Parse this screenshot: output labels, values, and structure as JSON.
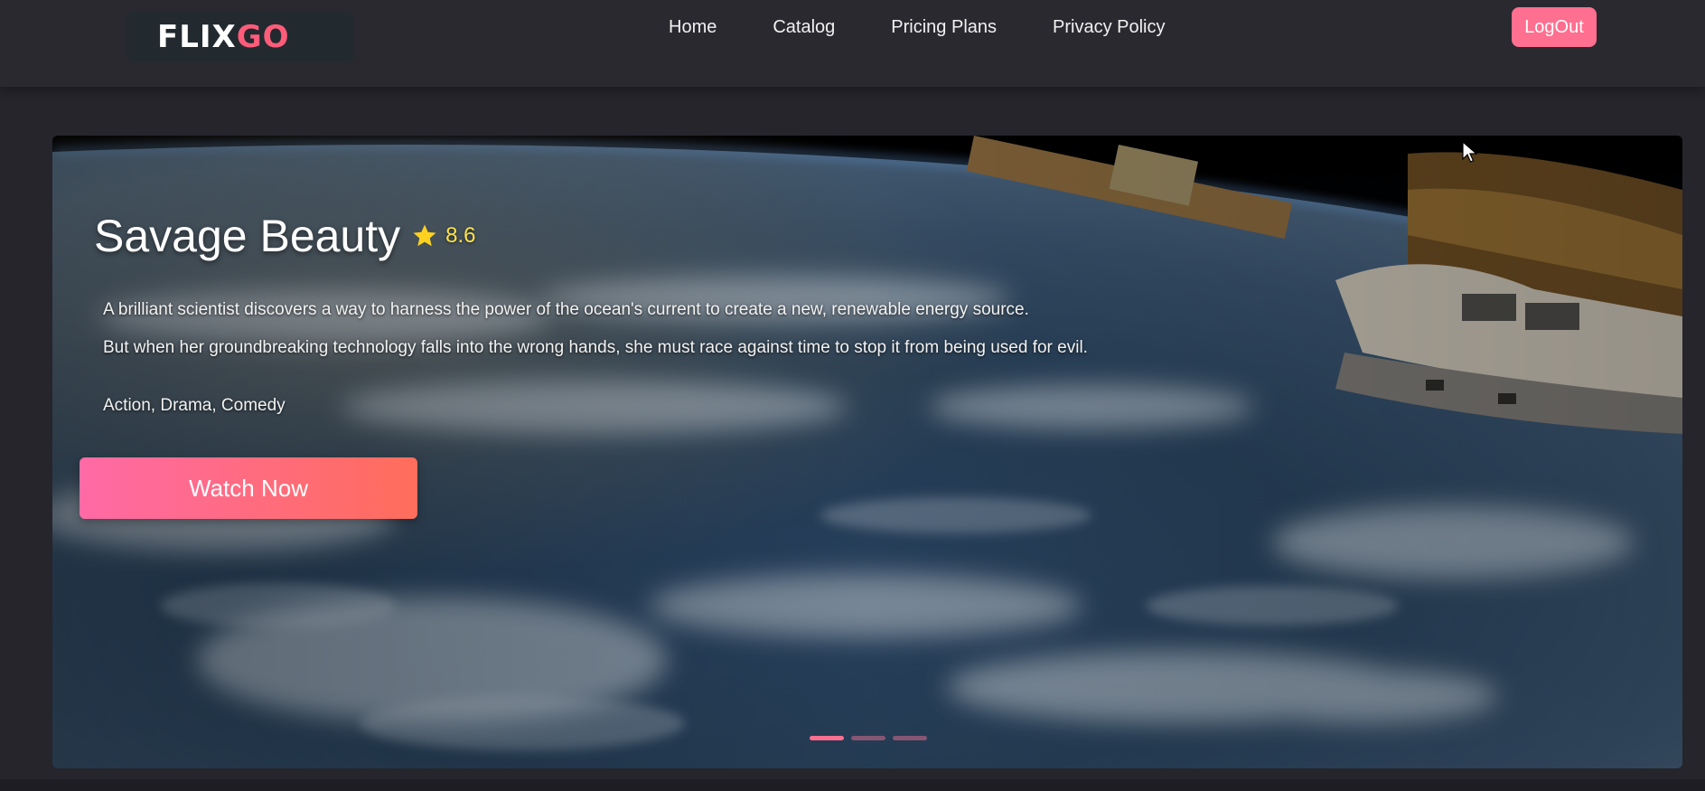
{
  "header": {
    "logo": {
      "part1": "FLIX",
      "part2": "GO"
    },
    "nav": [
      {
        "label": "Home"
      },
      {
        "label": "Catalog"
      },
      {
        "label": "Pricing Plans"
      },
      {
        "label": "Privacy Policy"
      }
    ],
    "logout_label": "LogOut"
  },
  "hero": {
    "title": "Savage Beauty",
    "rating": "8.6",
    "description_line1": "A brilliant scientist discovers a way to harness the power of the ocean's current to create a new, renewable energy source.",
    "description_line2": "But when her groundbreaking technology falls into the wrong hands, she must race against time to stop it from being used for evil.",
    "genres": "Action, Drama, Comedy",
    "watch_label": "Watch Now",
    "slides": 3,
    "active_slide": 1
  },
  "colors": {
    "accent": "#ff6f8f",
    "rating": "#ffe24a",
    "background": "#26252c"
  },
  "icons": {
    "rating": "star-icon",
    "pointer": "cursor-icon"
  }
}
